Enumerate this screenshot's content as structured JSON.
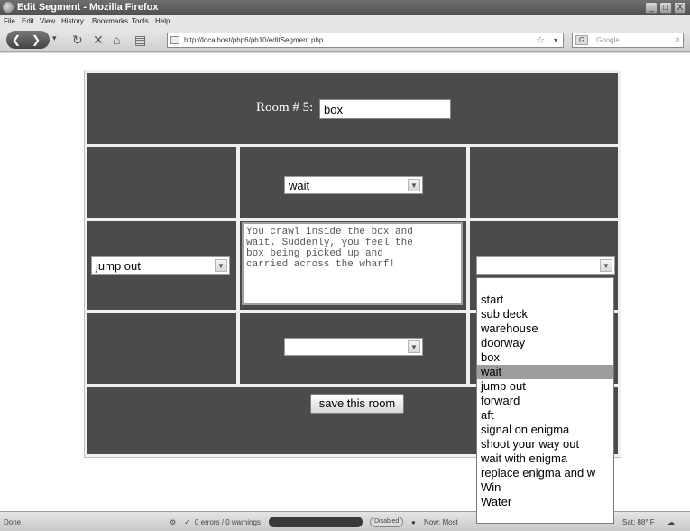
{
  "window": {
    "title": "Edit Segment - Mozilla Firefox",
    "buttons": [
      "_",
      "□",
      "X"
    ]
  },
  "menu": [
    "File",
    "Edit",
    "View",
    "History",
    "Bookmarks",
    "Tools",
    "Help"
  ],
  "nav": {
    "url": "http://localhost/php6/ph10/editSegment.php",
    "search_placeholder": "Google"
  },
  "form": {
    "room_label": "Room # 5:",
    "room_value": "box",
    "north_value": "wait",
    "west_value": "jump out",
    "east_value": "",
    "south_value": "",
    "description": "You crawl inside the box and\nwait. Suddenly, you feel the\nbox being picked up and\ncarried across the wharf!",
    "save_label": "save this room"
  },
  "dropdown": {
    "options": [
      "",
      "start",
      "sub deck",
      "warehouse",
      "doorway",
      "box",
      "wait",
      "jump out",
      "forward",
      "aft",
      "signal on enigma",
      "shoot your way out",
      "wait with enigma",
      "replace enigma and w",
      "Win",
      "Water"
    ],
    "selected": "wait"
  },
  "status": {
    "done": "Done",
    "errors": "0 errors / 0 warnings",
    "disabled": "Disabled",
    "now": "Now: Most",
    "weather": "Sat: 88° F"
  }
}
